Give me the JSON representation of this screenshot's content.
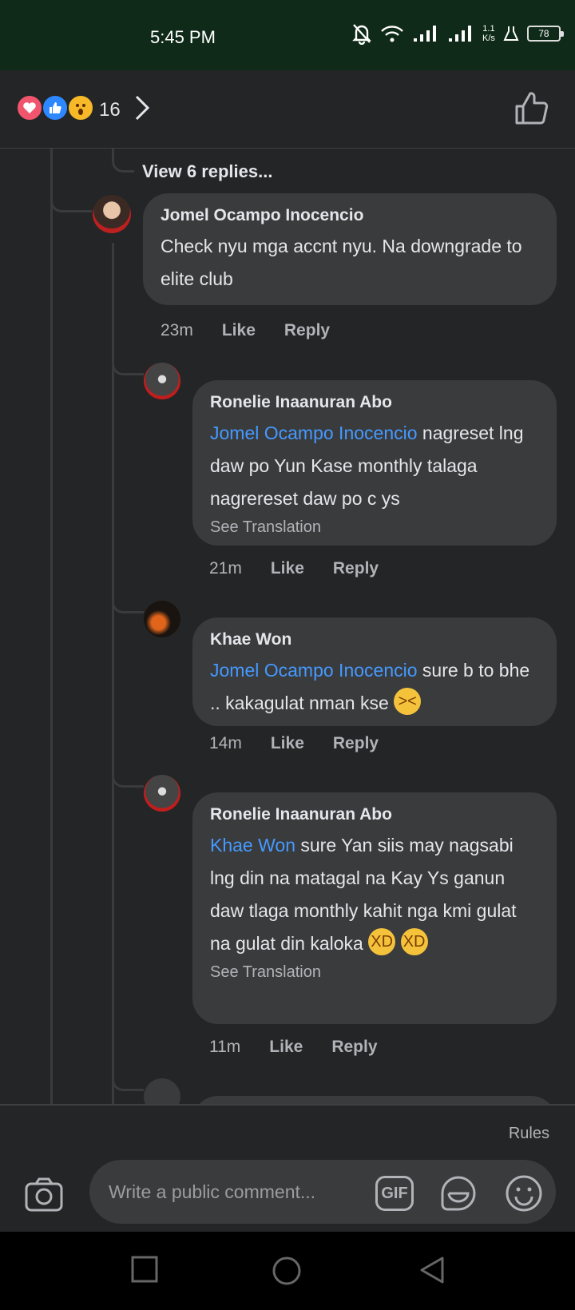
{
  "status": {
    "time": "5:45 PM",
    "net_speed_value": "1.1",
    "net_speed_unit": "K/s",
    "battery": "78"
  },
  "reactions": {
    "count": "16",
    "icons": [
      "heart-icon",
      "like-icon",
      "wow-icon"
    ]
  },
  "thread": {
    "view_replies": "View 6 replies..."
  },
  "comments": [
    {
      "author": "Jomel Ocampo Inocencio",
      "mention": "",
      "text": "Check nyu mga accnt nyu. Na downgrade to elite club",
      "time": "23m",
      "like": "Like",
      "reply": "Reply"
    },
    {
      "author": "Ronelie Inaanuran Abo",
      "mention": "Jomel Ocampo Inocencio",
      "text": " nagreset lng daw po Yun Kase monthly talaga nagrereset daw po c ys",
      "see_translation": "See Translation",
      "time": "21m",
      "like": "Like",
      "reply": "Reply"
    },
    {
      "author": "Khae Won",
      "mention": "Jomel Ocampo Inocencio",
      "text": " sure b to bhe .. kakagulat nman kse ",
      "emoji": "sneezing-face",
      "time": "14m",
      "like": "Like",
      "reply": "Reply"
    },
    {
      "author": "Ronelie Inaanuran Abo",
      "mention": "Khae Won",
      "text": " sure Yan siis may nagsabi lng din na matagal na Kay Ys ganun daw tlaga monthly kahit nga kmi gulat na gulat din kaloka ",
      "emoji": "rolling-on-floor-laughing",
      "see_translation": "See Translation",
      "time": "11m",
      "like": "Like",
      "reply": "Reply"
    }
  ],
  "composer": {
    "rules": "Rules",
    "placeholder": "Write a public comment...",
    "gif": "GIF"
  },
  "colors": {
    "background": "#242526",
    "bubble": "#3a3b3c",
    "mention": "#4599ff",
    "status_bar": "#0f2a18"
  }
}
